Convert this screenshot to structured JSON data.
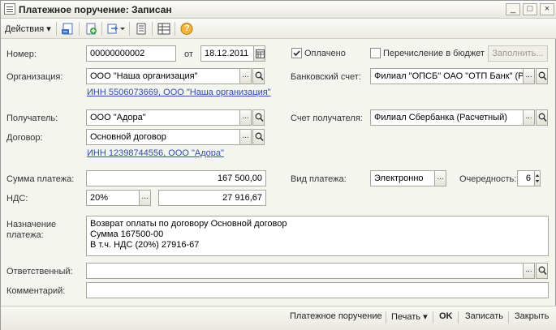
{
  "window": {
    "title": "Платежное поручение: Записан"
  },
  "titlebar_buttons": {
    "minimize": "_",
    "maximize": "□",
    "close": "×"
  },
  "toolbar": {
    "actions_label": "Действия",
    "actions_arrow": "▾",
    "help_glyph": "?"
  },
  "form": {
    "number_label": "Номер:",
    "number_value": "00000000002",
    "date_prefix": "от",
    "date_value": "18.12.2011",
    "paid_label": "Оплачено",
    "budget_label": "Перечисление в бюджет",
    "fill_button": "Заполнить...",
    "org_label": "Организация:",
    "org_value": "ООО \"Наша организация\"",
    "org_inn_link": "ИНН 5506073669, ООО \"Наша организация\"",
    "bank_account_label": "Банковский счет:",
    "bank_account_value": "Филиал \"ОПСБ\" ОАО \"ОТП Банк\" (Р",
    "recipient_label": "Получатель:",
    "recipient_value": "ООО \"Адора\"",
    "recipient_account_label": "Счет получателя:",
    "recipient_account_value": "Филиал Сбербанка  (Расчетный)",
    "contract_label": "Договор:",
    "contract_value": "Основной договор",
    "recipient_inn_link": "ИНН 12398744556, ООО \"Адора\"",
    "sum_label": "Сумма платежа:",
    "sum_value": "167 500,00",
    "payment_type_label": "Вид платежа:",
    "payment_type_value": "Электронно",
    "priority_label": "Очередность:",
    "priority_value": "6",
    "vat_label": "НДС:",
    "vat_rate_value": "20%",
    "vat_sum_value": "27 916,67",
    "purpose_label_1": "Назначение",
    "purpose_label_2": "платежа:",
    "purpose_line_1": "Возврат оплаты по договору Основной договор",
    "purpose_line_2": "Сумма 167500-00",
    "purpose_line_3": "В т.ч. НДС  (20%) 27916-67",
    "responsible_label": "Ответственный:",
    "responsible_value": "",
    "comment_label": "Комментарий:",
    "comment_value": "",
    "dots": "..."
  },
  "statusbar": {
    "print_form_label": "Платежное поручение",
    "print_label": "Печать",
    "print_arrow": "▾",
    "ok_label": "OK",
    "save_label": "Записать",
    "close_label": "Закрыть"
  },
  "colors": {
    "link": "#2f4ea8",
    "window_bg": "#f5f5f0"
  }
}
